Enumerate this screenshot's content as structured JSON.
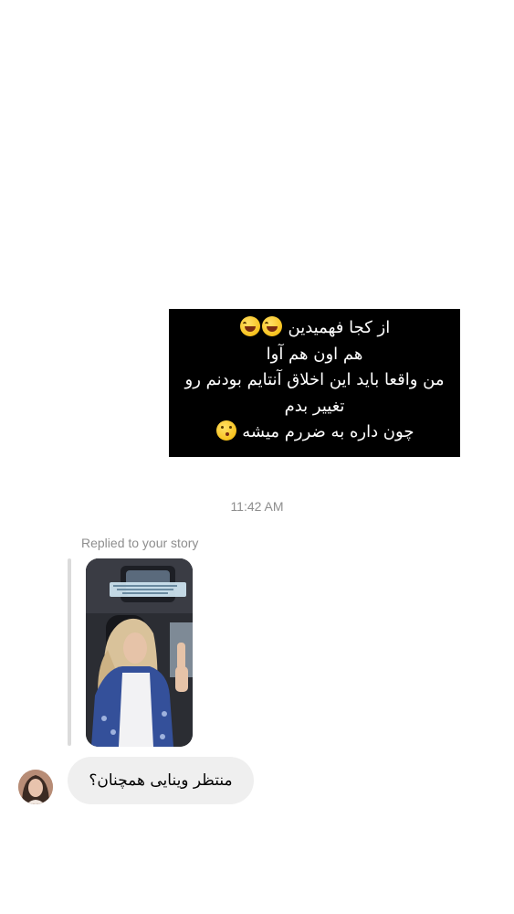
{
  "story_reply_message": {
    "lines": [
      "از کجا فهمیدین",
      "هم اون هم آوا",
      "من واقعا باید این اخلاق آنتایم بودنم رو",
      "تغییر بدم",
      "چون داره به ضررم میشه"
    ],
    "emojis": {
      "line1": "rolling-on-floor-laughing-emoji",
      "line5": "face-with-hand-over-mouth-emoji"
    },
    "background_color": "#000000",
    "text_color": "#ffffff"
  },
  "timestamp": "11:42 AM",
  "reply": {
    "label": "Replied to your story",
    "story_thumbnail": "story-selfie-in-car",
    "incoming_message": "منتظر وینایی همچنان؟",
    "avatar": "sender-avatar"
  },
  "colors": {
    "bubble_bg": "#efefef",
    "meta_text": "#8e8e8e",
    "reply_bar": "#dbdbdb"
  }
}
